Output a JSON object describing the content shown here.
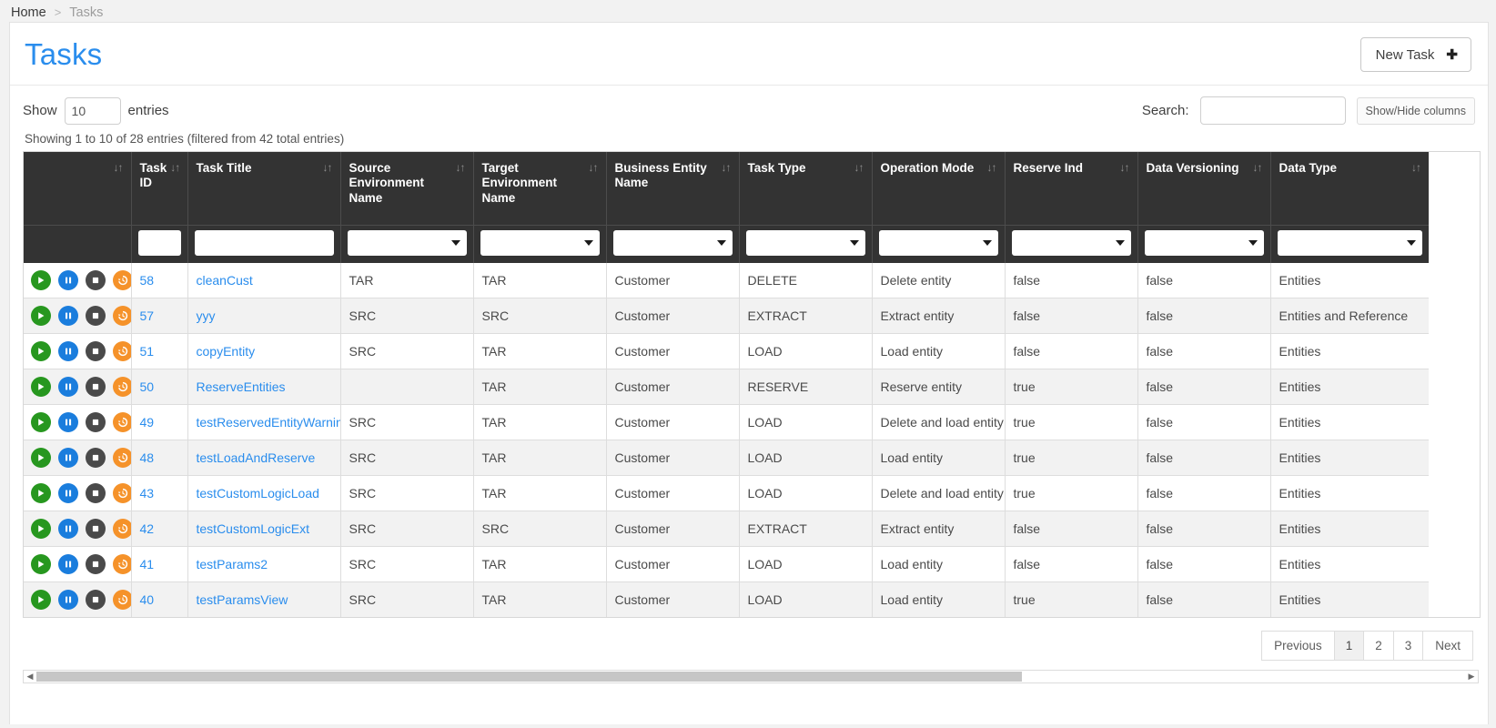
{
  "breadcrumb": {
    "home": "Home",
    "separator": ">",
    "current": "Tasks"
  },
  "header": {
    "title": "Tasks",
    "new_task_label": "New Task",
    "new_task_plus": "✚"
  },
  "controls": {
    "show_label": "Show",
    "entries_label": "entries",
    "length_value": "10",
    "search_label": "Search:",
    "search_value": "",
    "search_placeholder": "",
    "showhide_label": "Show/Hide columns"
  },
  "info": "Showing 1 to 10 of 28 entries (filtered from 42 total entries)",
  "table": {
    "sort_icon": "↓↑",
    "columns": [
      {
        "label": "",
        "type": "none",
        "filter": "none"
      },
      {
        "label": "Task ID",
        "type": "sort",
        "filter": "text"
      },
      {
        "label": "Task Title",
        "type": "sort",
        "filter": "text"
      },
      {
        "label": "Source Environment Name",
        "type": "sort",
        "filter": "select"
      },
      {
        "label": "Target Environment Name",
        "type": "sort",
        "filter": "select"
      },
      {
        "label": "Business Entity Name",
        "type": "sort",
        "filter": "select"
      },
      {
        "label": "Task Type",
        "type": "sort",
        "filter": "select"
      },
      {
        "label": "Operation Mode",
        "type": "sort",
        "filter": "select"
      },
      {
        "label": "Reserve Ind",
        "type": "sort",
        "filter": "select"
      },
      {
        "label": "Data Versioning",
        "type": "sort",
        "filter": "select"
      },
      {
        "label": "Data Type",
        "type": "sort",
        "filter": "select"
      }
    ],
    "filter_values": [
      "",
      "",
      "",
      "",
      "",
      "",
      "",
      "",
      "",
      "",
      ""
    ],
    "action_icons": [
      "play-icon",
      "pause-icon",
      "stop-icon",
      "history-icon"
    ],
    "rows": [
      {
        "task_id": "58",
        "task_title": "cleanCust",
        "source_env": "TAR",
        "target_env": "TAR",
        "business_entity": "Customer",
        "task_type": "DELETE",
        "operation_mode": "Delete entity",
        "reserve_ind": "false",
        "data_versioning": "false",
        "data_type": "Entities"
      },
      {
        "task_id": "57",
        "task_title": "yyy",
        "source_env": "SRC",
        "target_env": "SRC",
        "business_entity": "Customer",
        "task_type": "EXTRACT",
        "operation_mode": "Extract entity",
        "reserve_ind": "false",
        "data_versioning": "false",
        "data_type": "Entities and Reference"
      },
      {
        "task_id": "51",
        "task_title": "copyEntity",
        "source_env": "SRC",
        "target_env": "TAR",
        "business_entity": "Customer",
        "task_type": "LOAD",
        "operation_mode": "Load entity",
        "reserve_ind": "false",
        "data_versioning": "false",
        "data_type": "Entities"
      },
      {
        "task_id": "50",
        "task_title": "ReserveEntities",
        "source_env": "",
        "target_env": "TAR",
        "business_entity": "Customer",
        "task_type": "RESERVE",
        "operation_mode": "Reserve entity",
        "reserve_ind": "true",
        "data_versioning": "false",
        "data_type": "Entities"
      },
      {
        "task_id": "49",
        "task_title": "testReservedEntityWarning",
        "source_env": "SRC",
        "target_env": "TAR",
        "business_entity": "Customer",
        "task_type": "LOAD",
        "operation_mode": "Delete and load entity",
        "reserve_ind": "true",
        "data_versioning": "false",
        "data_type": "Entities"
      },
      {
        "task_id": "48",
        "task_title": "testLoadAndReserve",
        "source_env": "SRC",
        "target_env": "TAR",
        "business_entity": "Customer",
        "task_type": "LOAD",
        "operation_mode": "Load entity",
        "reserve_ind": "true",
        "data_versioning": "false",
        "data_type": "Entities"
      },
      {
        "task_id": "43",
        "task_title": "testCustomLogicLoad",
        "source_env": "SRC",
        "target_env": "TAR",
        "business_entity": "Customer",
        "task_type": "LOAD",
        "operation_mode": "Delete and load entity",
        "reserve_ind": "true",
        "data_versioning": "false",
        "data_type": "Entities"
      },
      {
        "task_id": "42",
        "task_title": "testCustomLogicExt",
        "source_env": "SRC",
        "target_env": "SRC",
        "business_entity": "Customer",
        "task_type": "EXTRACT",
        "operation_mode": "Extract entity",
        "reserve_ind": "false",
        "data_versioning": "false",
        "data_type": "Entities"
      },
      {
        "task_id": "41",
        "task_title": "testParams2",
        "source_env": "SRC",
        "target_env": "TAR",
        "business_entity": "Customer",
        "task_type": "LOAD",
        "operation_mode": "Load entity",
        "reserve_ind": "false",
        "data_versioning": "false",
        "data_type": "Entities"
      },
      {
        "task_id": "40",
        "task_title": "testParamsView",
        "source_env": "SRC",
        "target_env": "TAR",
        "business_entity": "Customer",
        "task_type": "LOAD",
        "operation_mode": "Load entity",
        "reserve_ind": "true",
        "data_versioning": "false",
        "data_type": "Entities"
      }
    ]
  },
  "pagination": {
    "previous": "Previous",
    "pages": [
      "1",
      "2",
      "3"
    ],
    "active_page": "1",
    "next": "Next"
  },
  "scrollbar": {
    "left_arrow": "◀",
    "right_arrow": "▶"
  },
  "colors": {
    "accent_blue": "#2a8ded",
    "header_dark": "#333333",
    "play_green": "#27971f",
    "pause_blue": "#1a7ddd",
    "stop_gray": "#4a4a4a",
    "history_orange": "#f5922a"
  }
}
